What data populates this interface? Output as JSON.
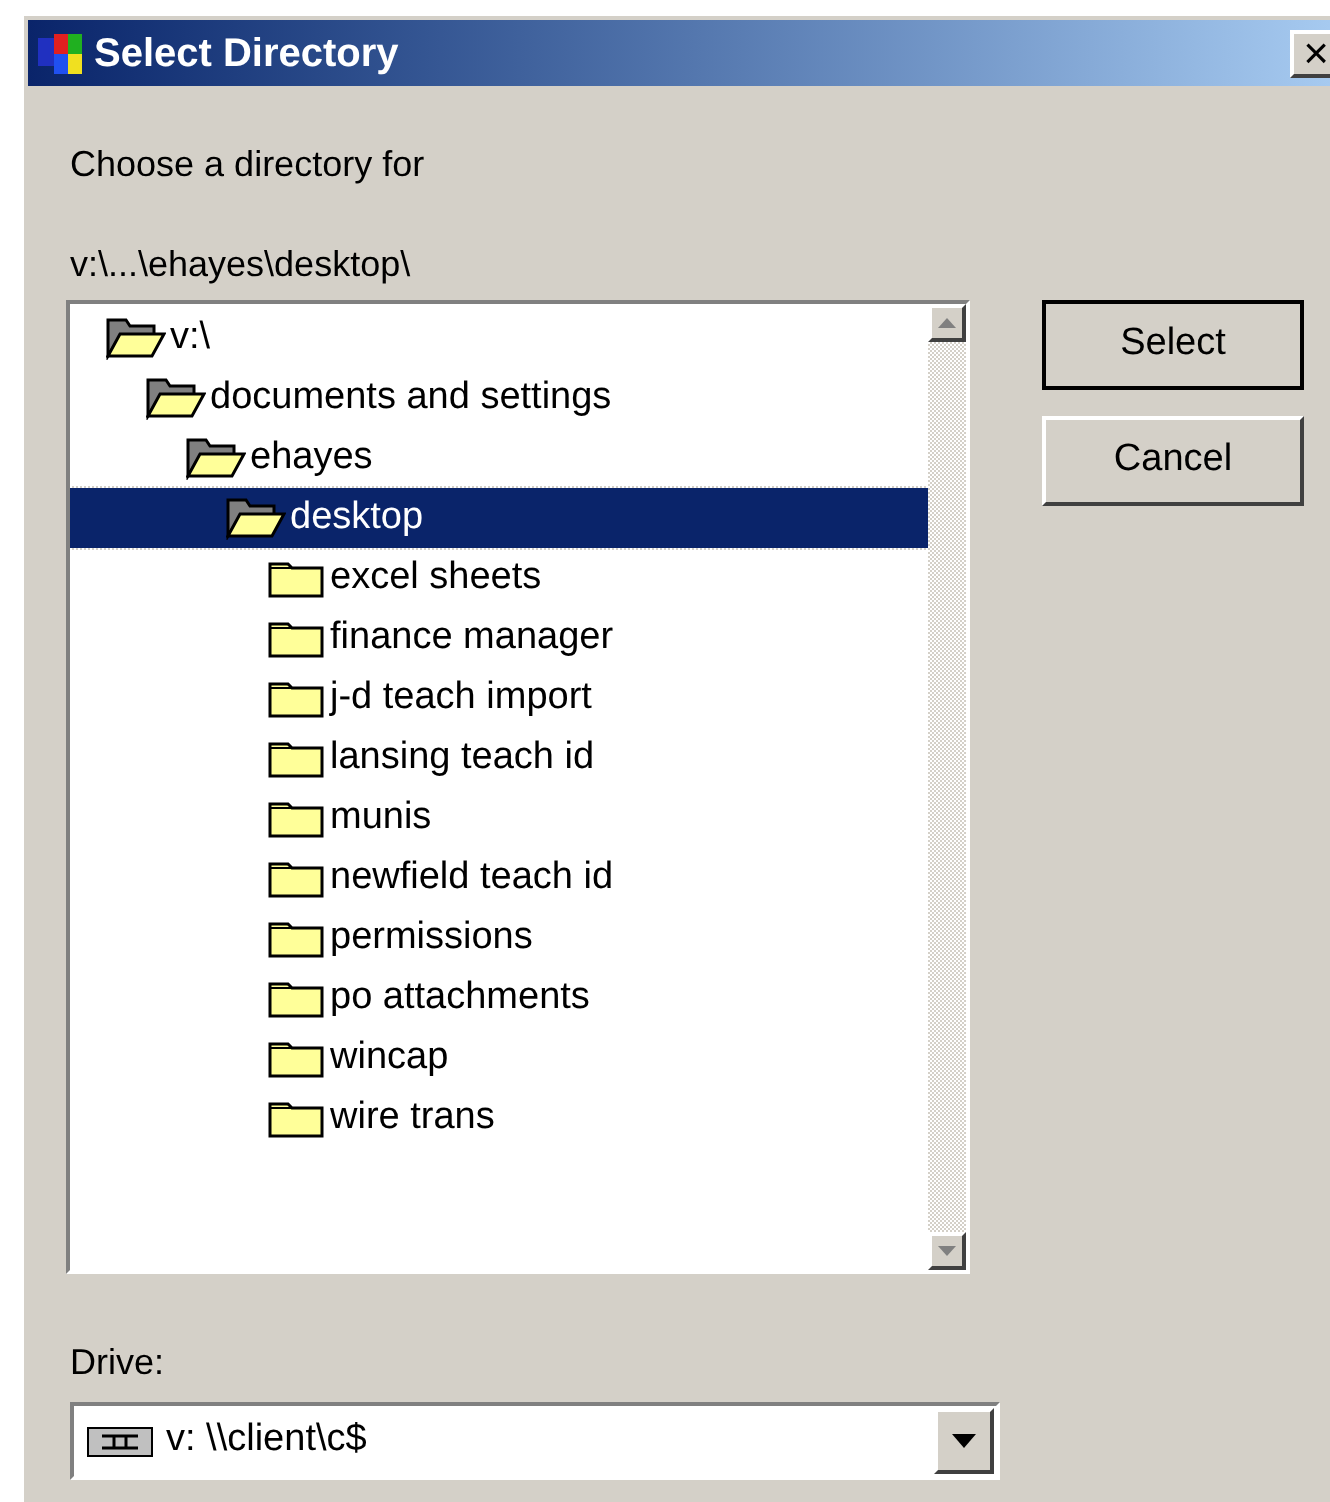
{
  "window": {
    "title": "Select Directory",
    "close_glyph": "×"
  },
  "prompt": "Choose a directory for",
  "current_path": "v:\\...\\ehayes\\desktop\\",
  "tree": [
    {
      "label": "v:\\",
      "expanded": true,
      "selected": false,
      "children": [
        {
          "label": "documents and settings",
          "expanded": true,
          "selected": false,
          "children": [
            {
              "label": "ehayes",
              "expanded": true,
              "selected": false,
              "children": [
                {
                  "label": "desktop",
                  "expanded": true,
                  "selected": true,
                  "children": [
                    {
                      "label": "excel sheets",
                      "expanded": false,
                      "selected": false
                    },
                    {
                      "label": "finance manager",
                      "expanded": false,
                      "selected": false
                    },
                    {
                      "label": "j-d teach import",
                      "expanded": false,
                      "selected": false
                    },
                    {
                      "label": "lansing teach id",
                      "expanded": false,
                      "selected": false
                    },
                    {
                      "label": "munis",
                      "expanded": false,
                      "selected": false
                    },
                    {
                      "label": "newfield teach id",
                      "expanded": false,
                      "selected": false
                    },
                    {
                      "label": "permissions",
                      "expanded": false,
                      "selected": false
                    },
                    {
                      "label": "po attachments",
                      "expanded": false,
                      "selected": false
                    },
                    {
                      "label": "wincap",
                      "expanded": false,
                      "selected": false
                    },
                    {
                      "label": "wire trans",
                      "expanded": false,
                      "selected": false
                    }
                  ]
                }
              ]
            }
          ]
        }
      ]
    }
  ],
  "buttons": [
    "Select",
    "Cancel"
  ],
  "drive": {
    "label": "Drive:",
    "value": "v: \\\\client\\c$"
  }
}
